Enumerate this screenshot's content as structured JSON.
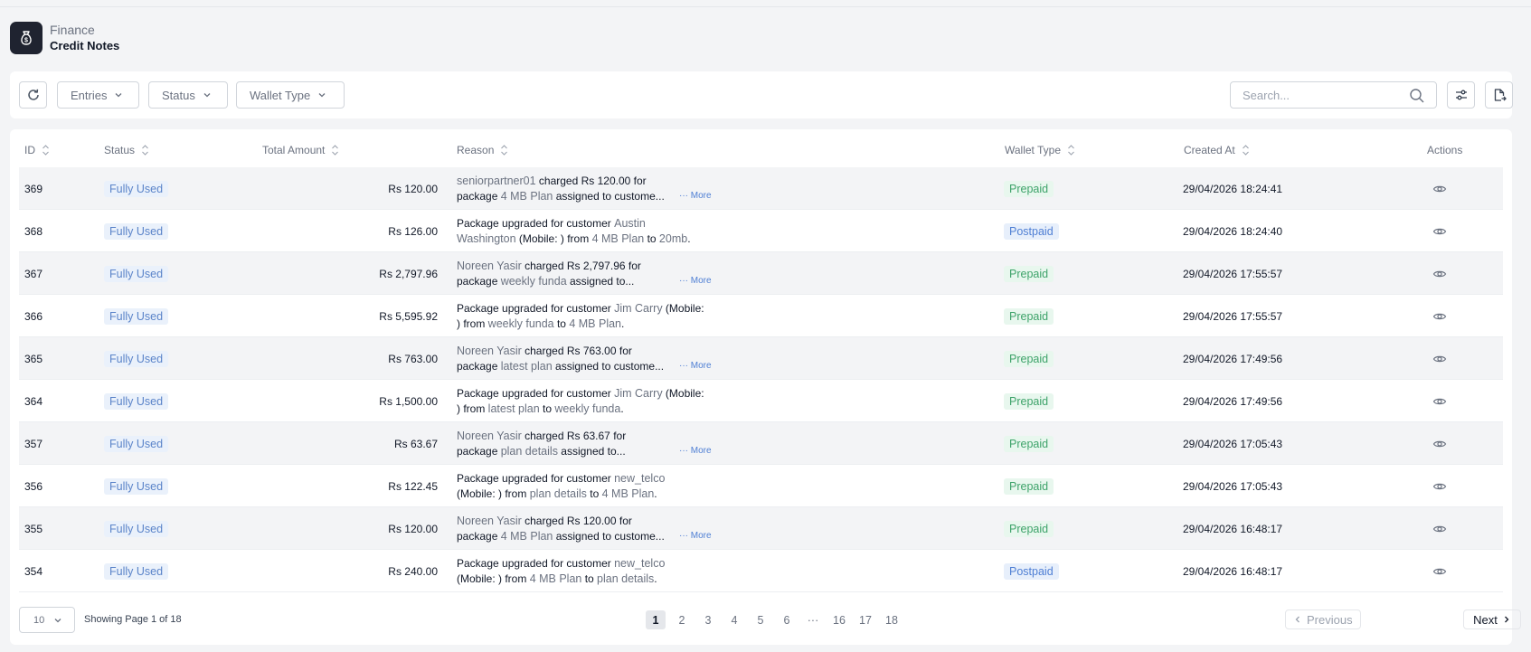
{
  "header": {
    "section": "Finance",
    "title": "Credit Notes"
  },
  "toolbar": {
    "entries_label": "Entries",
    "status_label": "Status",
    "wallet_label": "Wallet Type",
    "search_placeholder": "Search..."
  },
  "table": {
    "headers": {
      "id": "ID",
      "status": "Status",
      "total_amount": "Total Amount",
      "reason": "Reason",
      "wallet_type": "Wallet Type",
      "created_at": "Created At",
      "actions": "Actions"
    },
    "more_label": "··· More",
    "rows": [
      {
        "id": "369",
        "status": "Fully Used",
        "amount": "Rs 120.00",
        "reason_line1": [
          {
            "t": "seniorpartner01",
            "h": true
          },
          {
            "t": " charged Rs 120.00 for"
          }
        ],
        "reason_line2": [
          {
            "t": "package "
          },
          {
            "t": "4 MB Plan",
            "h": true
          },
          {
            "t": " assigned to custome..."
          }
        ],
        "more": true,
        "wallet": "Prepaid",
        "created": "29/04/2026 18:24:41"
      },
      {
        "id": "368",
        "status": "Fully Used",
        "amount": "Rs 126.00",
        "reason_line1": [
          {
            "t": "Package upgraded for customer "
          },
          {
            "t": "Austin",
            "h": true
          }
        ],
        "reason_line2": [
          {
            "t": "Washington",
            "h": true
          },
          {
            "t": " (Mobile: ) from "
          },
          {
            "t": "4 MB Plan",
            "h": true
          },
          {
            "t": " to "
          },
          {
            "t": "20mb",
            "h": true
          },
          {
            "t": "."
          }
        ],
        "more": false,
        "wallet": "Postpaid",
        "created": "29/04/2026 18:24:40"
      },
      {
        "id": "367",
        "status": "Fully Used",
        "amount": "Rs 2,797.96",
        "reason_line1": [
          {
            "t": "Noreen Yasir",
            "h": true
          },
          {
            "t": " charged Rs 2,797.96 for"
          }
        ],
        "reason_line2": [
          {
            "t": "package "
          },
          {
            "t": "weekly funda",
            "h": true
          },
          {
            "t": " assigned to..."
          }
        ],
        "more": true,
        "wallet": "Prepaid",
        "created": "29/04/2026 17:55:57"
      },
      {
        "id": "366",
        "status": "Fully Used",
        "amount": "Rs 5,595.92",
        "reason_line1": [
          {
            "t": "Package upgraded for customer "
          },
          {
            "t": "Jim Carry",
            "h": true
          },
          {
            "t": " (Mobile:"
          }
        ],
        "reason_line2": [
          {
            "t": ") from "
          },
          {
            "t": "weekly funda",
            "h": true
          },
          {
            "t": " to "
          },
          {
            "t": "4 MB Plan",
            "h": true
          },
          {
            "t": "."
          }
        ],
        "more": false,
        "wallet": "Prepaid",
        "created": "29/04/2026 17:55:57"
      },
      {
        "id": "365",
        "status": "Fully Used",
        "amount": "Rs 763.00",
        "reason_line1": [
          {
            "t": "Noreen Yasir",
            "h": true
          },
          {
            "t": " charged Rs 763.00 for"
          }
        ],
        "reason_line2": [
          {
            "t": "package "
          },
          {
            "t": "latest plan",
            "h": true
          },
          {
            "t": " assigned to custome..."
          }
        ],
        "more": true,
        "wallet": "Prepaid",
        "created": "29/04/2026 17:49:56"
      },
      {
        "id": "364",
        "status": "Fully Used",
        "amount": "Rs 1,500.00",
        "reason_line1": [
          {
            "t": "Package upgraded for customer "
          },
          {
            "t": "Jim Carry",
            "h": true
          },
          {
            "t": " (Mobile:"
          }
        ],
        "reason_line2": [
          {
            "t": ") from "
          },
          {
            "t": "latest plan",
            "h": true
          },
          {
            "t": " to "
          },
          {
            "t": "weekly funda",
            "h": true
          },
          {
            "t": "."
          }
        ],
        "more": false,
        "wallet": "Prepaid",
        "created": "29/04/2026 17:49:56"
      },
      {
        "id": "357",
        "status": "Fully Used",
        "amount": "Rs 63.67",
        "reason_line1": [
          {
            "t": "Noreen Yasir",
            "h": true
          },
          {
            "t": " charged Rs 63.67 for"
          }
        ],
        "reason_line2": [
          {
            "t": "package "
          },
          {
            "t": "plan details",
            "h": true
          },
          {
            "t": " assigned to..."
          }
        ],
        "more": true,
        "wallet": "Prepaid",
        "created": "29/04/2026 17:05:43"
      },
      {
        "id": "356",
        "status": "Fully Used",
        "amount": "Rs 122.45",
        "reason_line1": [
          {
            "t": "Package upgraded for customer "
          },
          {
            "t": "new_telco",
            "h": true
          }
        ],
        "reason_line2": [
          {
            "t": "(Mobile: ) from "
          },
          {
            "t": "plan details",
            "h": true
          },
          {
            "t": " to "
          },
          {
            "t": "4 MB Plan",
            "h": true
          },
          {
            "t": "."
          }
        ],
        "more": false,
        "wallet": "Prepaid",
        "created": "29/04/2026 17:05:43"
      },
      {
        "id": "355",
        "status": "Fully Used",
        "amount": "Rs 120.00",
        "reason_line1": [
          {
            "t": "Noreen Yasir",
            "h": true
          },
          {
            "t": " charged Rs 120.00 for"
          }
        ],
        "reason_line2": [
          {
            "t": "package "
          },
          {
            "t": "4 MB Plan",
            "h": true
          },
          {
            "t": " assigned to custome..."
          }
        ],
        "more": true,
        "wallet": "Prepaid",
        "created": "29/04/2026 16:48:17"
      },
      {
        "id": "354",
        "status": "Fully Used",
        "amount": "Rs 240.00",
        "reason_line1": [
          {
            "t": "Package upgraded for customer "
          },
          {
            "t": "new_telco",
            "h": true
          }
        ],
        "reason_line2": [
          {
            "t": "(Mobile: ) from "
          },
          {
            "t": "4 MB Plan",
            "h": true
          },
          {
            "t": " to "
          },
          {
            "t": "plan details",
            "h": true
          },
          {
            "t": "."
          }
        ],
        "more": false,
        "wallet": "Postpaid",
        "created": "29/04/2026 16:48:17"
      }
    ]
  },
  "pagination": {
    "per_page": "10",
    "showing": "Showing Page 1 of 18",
    "pages": [
      "1",
      "2",
      "3",
      "4",
      "5",
      "6",
      "···",
      "16",
      "17",
      "18"
    ],
    "active_page": "1",
    "previous_label": "Previous",
    "next_label": "Next"
  },
  "colors": {
    "prepaid": "#3ea36a",
    "postpaid": "#4f7fd4",
    "fully_used": "#5b84c9"
  },
  "icons": {
    "logo": "money-bag-icon",
    "refresh": "refresh-icon",
    "search": "search-icon",
    "filter": "sliders-icon",
    "export": "export-file-icon",
    "view": "eye-icon"
  }
}
